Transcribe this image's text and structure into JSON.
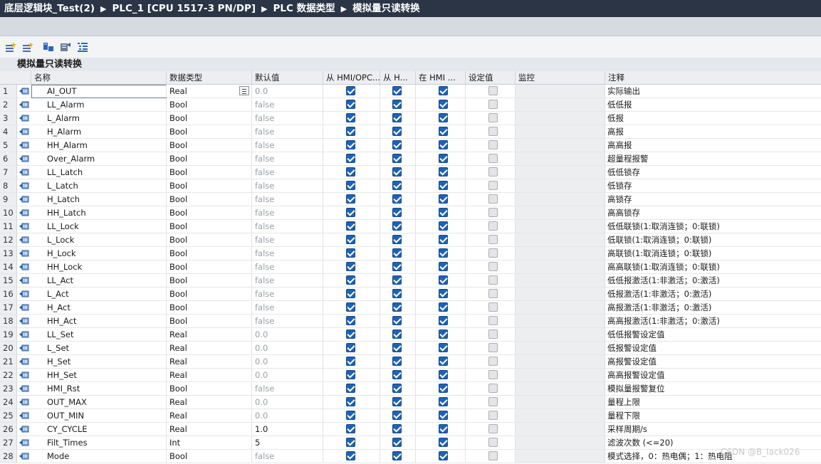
{
  "breadcrumb": [
    "底层逻辑块_Test(2)",
    "PLC_1 [CPU 1517-3 PN/DP]",
    "PLC 数据类型",
    "模拟量只读转换"
  ],
  "toolbar_icons": [
    "insert-row-icon",
    "add-row-icon",
    "expand-icon",
    "go-to-icon",
    "list-icon"
  ],
  "block_title": "模拟量只读转换",
  "columns": {
    "name": "名称",
    "datatype": "数据类型",
    "default": "默认值",
    "hmi_opc": "从 HMI/OPC...",
    "hmi_h": "从 H...",
    "in_hmi": "在 HMI ...",
    "setpoint": "设定值",
    "monitor": "监控",
    "comment": "注释"
  },
  "colors": {
    "title_bg": "#2b3546",
    "checkbox_on": "#1e62b4"
  },
  "rows": [
    {
      "num": "1",
      "name": "AI_OUT",
      "type": "Real",
      "default": "0.0",
      "comment": "实际输出"
    },
    {
      "num": "2",
      "name": "LL_Alarm",
      "type": "Bool",
      "default": "false",
      "comment": "低低报"
    },
    {
      "num": "3",
      "name": "L_Alarm",
      "type": "Bool",
      "default": "false",
      "comment": "低报"
    },
    {
      "num": "4",
      "name": "H_Alarm",
      "type": "Bool",
      "default": "false",
      "comment": "高报"
    },
    {
      "num": "5",
      "name": "HH_Alarm",
      "type": "Bool",
      "default": "false",
      "comment": "高高报"
    },
    {
      "num": "6",
      "name": "Over_Alarm",
      "type": "Bool",
      "default": "false",
      "comment": "超量程报警"
    },
    {
      "num": "7",
      "name": "LL_Latch",
      "type": "Bool",
      "default": "false",
      "comment": "低低锁存"
    },
    {
      "num": "8",
      "name": "L_Latch",
      "type": "Bool",
      "default": "false",
      "comment": "低锁存"
    },
    {
      "num": "9",
      "name": "H_Latch",
      "type": "Bool",
      "default": "false",
      "comment": "高锁存"
    },
    {
      "num": "10",
      "name": "HH_Latch",
      "type": "Bool",
      "default": "false",
      "comment": "高高锁存"
    },
    {
      "num": "11",
      "name": "LL_Lock",
      "type": "Bool",
      "default": "false",
      "comment": "低低联锁(1:取消连锁；0:联锁)"
    },
    {
      "num": "12",
      "name": "L_Lock",
      "type": "Bool",
      "default": "false",
      "comment": "低联锁(1:取消连锁；0:联锁)"
    },
    {
      "num": "13",
      "name": "H_Lock",
      "type": "Bool",
      "default": "false",
      "comment": "高联锁(1:取消连锁；0:联锁)"
    },
    {
      "num": "14",
      "name": "HH_Lock",
      "type": "Bool",
      "default": "false",
      "comment": "高高联锁(1:取消连锁；0:联锁)"
    },
    {
      "num": "15",
      "name": "LL_Act",
      "type": "Bool",
      "default": "false",
      "comment": "低低报激活(1:非激活；0:激活)"
    },
    {
      "num": "16",
      "name": "L_Act",
      "type": "Bool",
      "default": "false",
      "comment": "低报激活(1:非激活；0:激活)"
    },
    {
      "num": "17",
      "name": "H_Act",
      "type": "Bool",
      "default": "false",
      "comment": "高报激活(1:非激活；0:激活)"
    },
    {
      "num": "18",
      "name": "HH_Act",
      "type": "Bool",
      "default": "false",
      "comment": "高高报激活(1:非激活；0:激活)"
    },
    {
      "num": "19",
      "name": "LL_Set",
      "type": "Real",
      "default": "0.0",
      "comment": "低低报警设定值"
    },
    {
      "num": "20",
      "name": "L_Set",
      "type": "Real",
      "default": "0.0",
      "comment": "低报警设定值"
    },
    {
      "num": "21",
      "name": "H_Set",
      "type": "Real",
      "default": "0.0",
      "comment": "高报警设定值"
    },
    {
      "num": "22",
      "name": "HH_Set",
      "type": "Real",
      "default": "0.0",
      "comment": "高高报警设定值"
    },
    {
      "num": "23",
      "name": "HMI_Rst",
      "type": "Bool",
      "default": "false",
      "comment": "模拟量报警复位"
    },
    {
      "num": "24",
      "name": "OUT_MAX",
      "type": "Real",
      "default": "0.0",
      "comment": "量程上限"
    },
    {
      "num": "25",
      "name": "OUT_MIN",
      "type": "Real",
      "default": "0.0",
      "comment": "量程下限"
    },
    {
      "num": "26",
      "name": "CY_CYCLE",
      "type": "Real",
      "default": "1.0",
      "default_dark": true,
      "comment": "采样周期/s"
    },
    {
      "num": "27",
      "name": "Filt_Times",
      "type": "Int",
      "default": "5",
      "default_dark": true,
      "comment": "滤波次数 (<=20)"
    },
    {
      "num": "28",
      "name": "Mode",
      "type": "Bool",
      "default": "false",
      "comment": "模式选择，0：热电偶；1：热电阻"
    }
  ],
  "watermark": "CSDN @B_lack026"
}
